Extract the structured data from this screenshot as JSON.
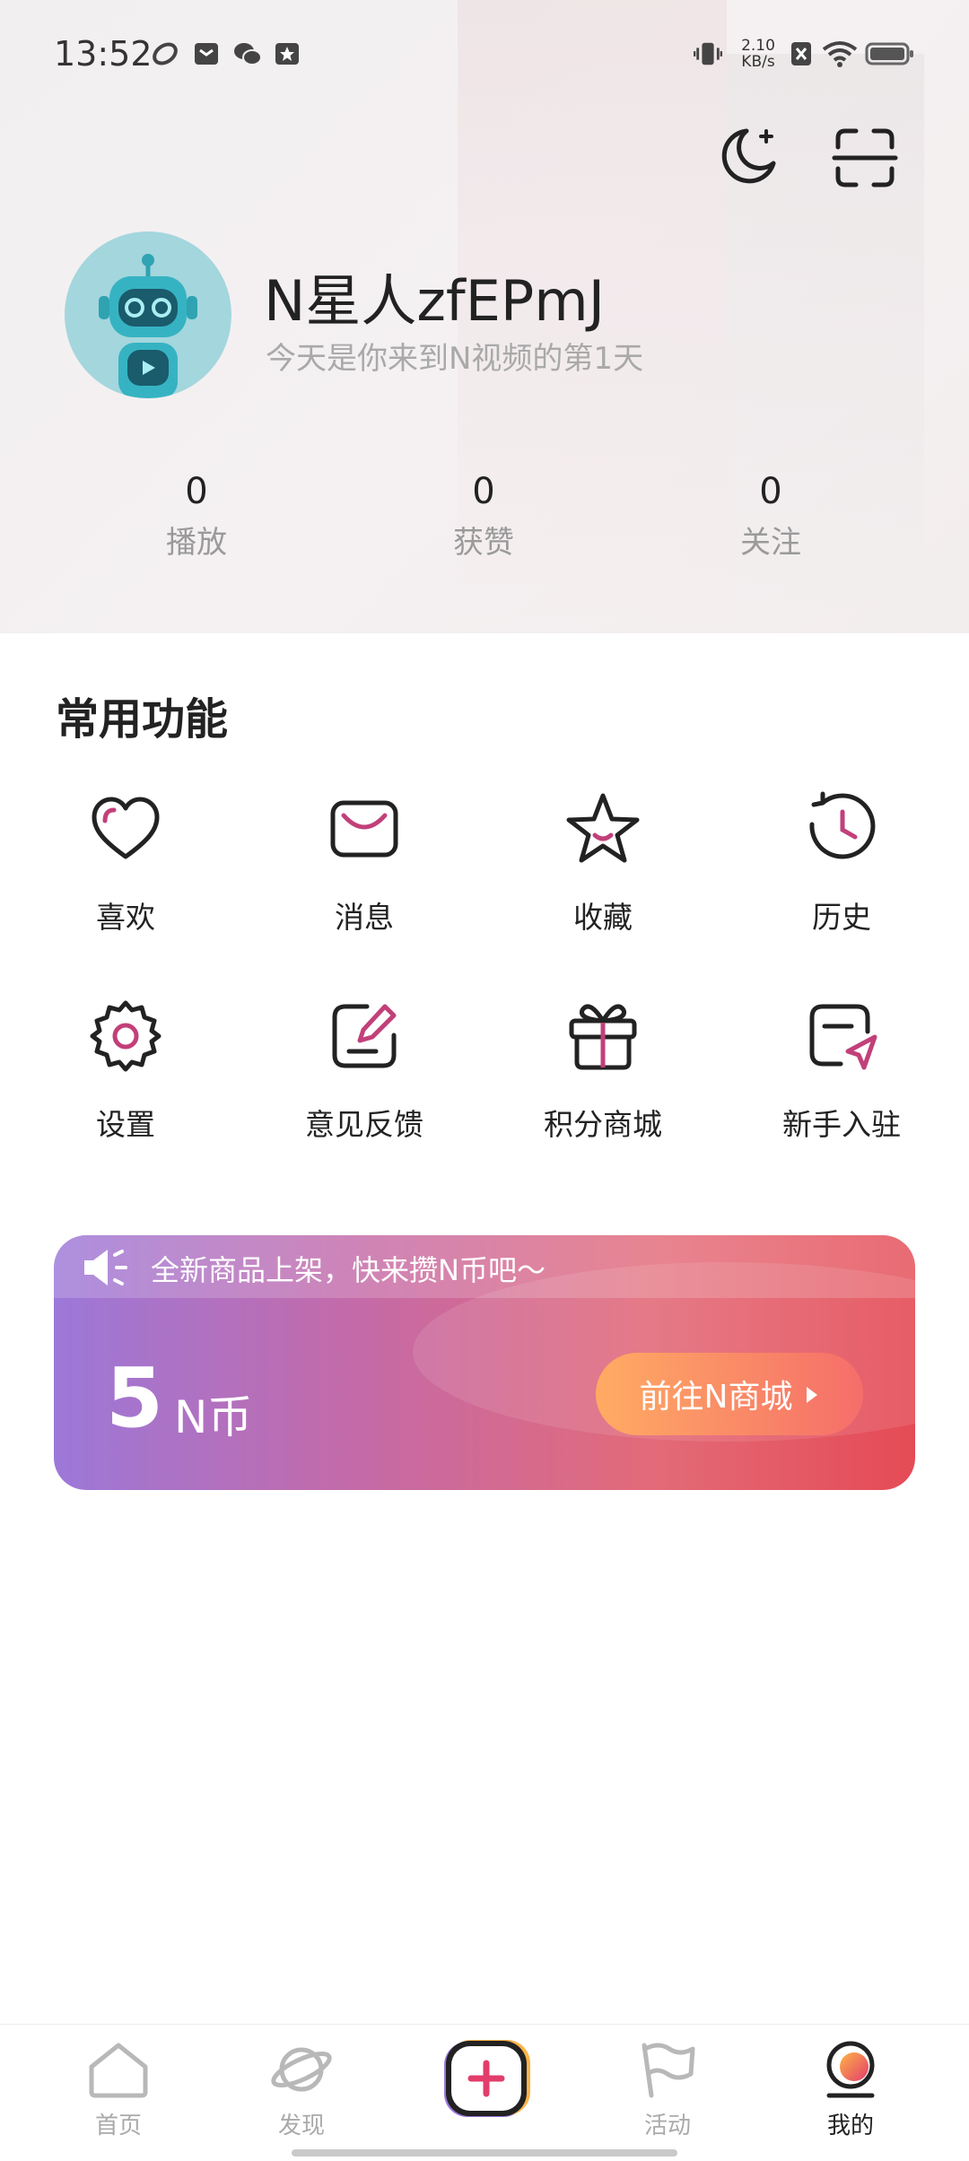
{
  "status_bar": {
    "time": "13:52",
    "net_speed_value": "2.10",
    "net_speed_unit": "KB/s"
  },
  "header": {
    "night_mode_icon": "moon-icon",
    "scan_icon": "scan-icon",
    "username": "N星人zfEPmJ",
    "subtitle": "今天是你来到N视频的第1天"
  },
  "stats": [
    {
      "value": "0",
      "label": "播放"
    },
    {
      "value": "0",
      "label": "获赞"
    },
    {
      "value": "0",
      "label": "关注"
    }
  ],
  "functions": {
    "title": "常用功能",
    "items": [
      {
        "label": "喜欢",
        "icon": "heart-icon"
      },
      {
        "label": "消息",
        "icon": "mail-icon"
      },
      {
        "label": "收藏",
        "icon": "star-icon"
      },
      {
        "label": "历史",
        "icon": "clock-icon"
      },
      {
        "label": "设置",
        "icon": "gear-icon"
      },
      {
        "label": "意见反馈",
        "icon": "edit-icon"
      },
      {
        "label": "积分商城",
        "icon": "gift-icon"
      },
      {
        "label": "新手入驻",
        "icon": "send-icon"
      }
    ]
  },
  "coin_card": {
    "notice": "全新商品上架，快来攒N币吧～",
    "coin_value": "5",
    "coin_unit": "N币",
    "mall_button": "前往N商城",
    "colors": {
      "start": "#9c78d9",
      "end": "#e54b55",
      "button_start": "#ffab63",
      "button_end": "#f56e6a",
      "accent": "#c2407a"
    }
  },
  "tabbar": {
    "items": [
      {
        "label": "首页",
        "icon": "home-icon",
        "active": false
      },
      {
        "label": "发现",
        "icon": "planet-icon",
        "active": false
      },
      {
        "label": "",
        "icon": "add-icon",
        "active": false
      },
      {
        "label": "活动",
        "icon": "flag-icon",
        "active": false
      },
      {
        "label": "我的",
        "icon": "profile-icon",
        "active": true
      }
    ]
  }
}
